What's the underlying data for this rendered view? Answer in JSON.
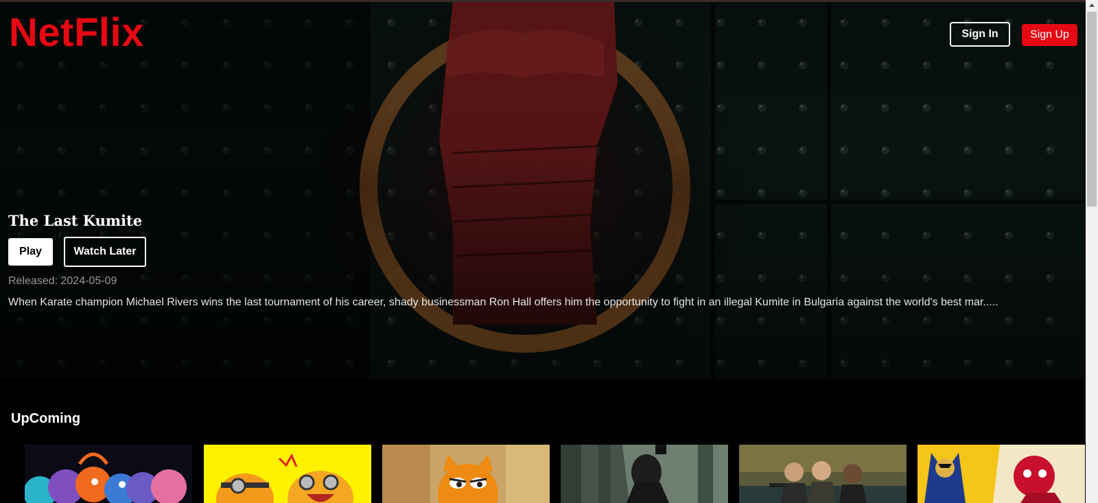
{
  "brand": {
    "name": "NetFlix",
    "accent": "#e50914"
  },
  "header": {
    "sign_in": "Sign In",
    "sign_up": "Sign Up"
  },
  "hero": {
    "title": "The Last Kumite",
    "play": "Play",
    "watch_later": "Watch Later",
    "released_label": "Released:",
    "released_date": "2024-05-09",
    "overview": "When Karate champion Michael Rivers wins the last tournament of his career, shady businessman Ron Hall offers him the opportunity to fight in an illegal Kumite in Bulgaria against the world's best mar....."
  },
  "sections": {
    "upcoming": {
      "title": "UpComing",
      "posters": [
        "animated-emotions-poster",
        "minions-poster",
        "orange-cat-poster",
        "forest-figure-poster",
        "action-trio-poster",
        "superhero-duo-poster"
      ]
    }
  }
}
